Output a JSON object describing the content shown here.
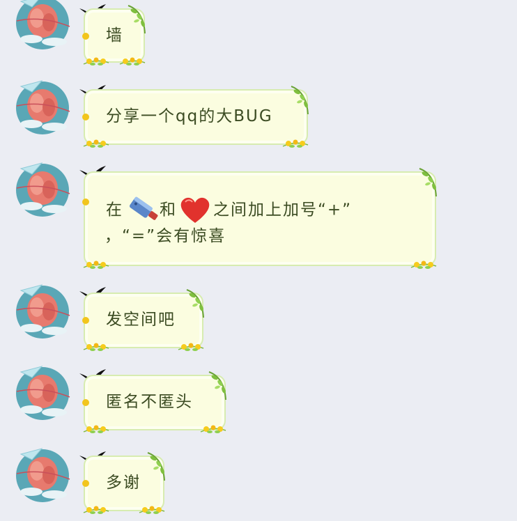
{
  "messages": [
    {
      "text": "墙"
    },
    {
      "text": "分享一个qq的大BUG"
    },
    {
      "text_before": "在",
      "text_mid": "和",
      "text_after": "之间加上加号“+”",
      "line2": "，“=”会有惊喜"
    },
    {
      "text": "发空间吧"
    },
    {
      "text": "匿名不匿头"
    },
    {
      "text": "多谢"
    }
  ],
  "icons": {
    "avatar": "avatar-illustration",
    "decoration": "swallow-bird-icon",
    "emoji1": "kitchen-knife-emoji",
    "emoji2": "red-heart-emoji"
  },
  "colors": {
    "background": "#ebedf3",
    "bubble_fill": "#fbfde0",
    "bubble_border": "#d7ecb0",
    "text": "#3b4b22"
  }
}
